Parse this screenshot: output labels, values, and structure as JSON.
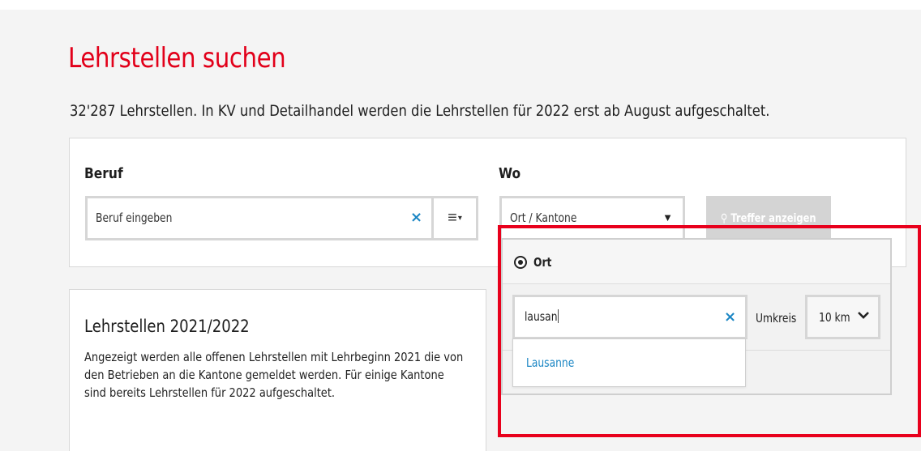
{
  "page": {
    "title": "Lehrstellen suchen",
    "subtitle": "32'287 Lehrstellen. In KV und Detailhandel werden die Lehrstellen für 2022 erst ab August aufgeschaltet."
  },
  "search": {
    "beruf_label": "Beruf",
    "beruf_placeholder": "Beruf eingeben",
    "clear_symbol": "×",
    "list_symbol": "≡",
    "list_caret": "▾",
    "wo_label": "Wo",
    "wo_value": "Ort / Kantone",
    "wo_caret": "▼",
    "submit_icon": "⚲",
    "submit_label": "Treffer anzeigen"
  },
  "ort_popover": {
    "mode_label": "Ort",
    "input_value": "lausan",
    "clear_symbol": "×",
    "umkreis_label": "Umkreis",
    "umkreis_value": "10 km",
    "suggestions": [
      "Lausanne"
    ]
  },
  "info": {
    "heading": "Lehrstellen 2021/2022",
    "text": "Angezeigt werden alle offenen Lehrstellen mit Lehrbeginn 2021 die von den Betrieben an die Kantone gemeldet werden. Für einige Kantone sind bereits Lehrstellen für 2022 aufgeschaltet."
  },
  "colors": {
    "brand_red": "#e2001a",
    "link_blue": "#1b86c4",
    "highlight_red": "#e8001c"
  },
  "icons": {
    "clear": "close-icon",
    "list": "list-menu-icon",
    "dropdown": "caret-down-icon",
    "search": "search-icon",
    "radio": "radio-selected-icon",
    "chevron": "chevron-down-icon"
  }
}
